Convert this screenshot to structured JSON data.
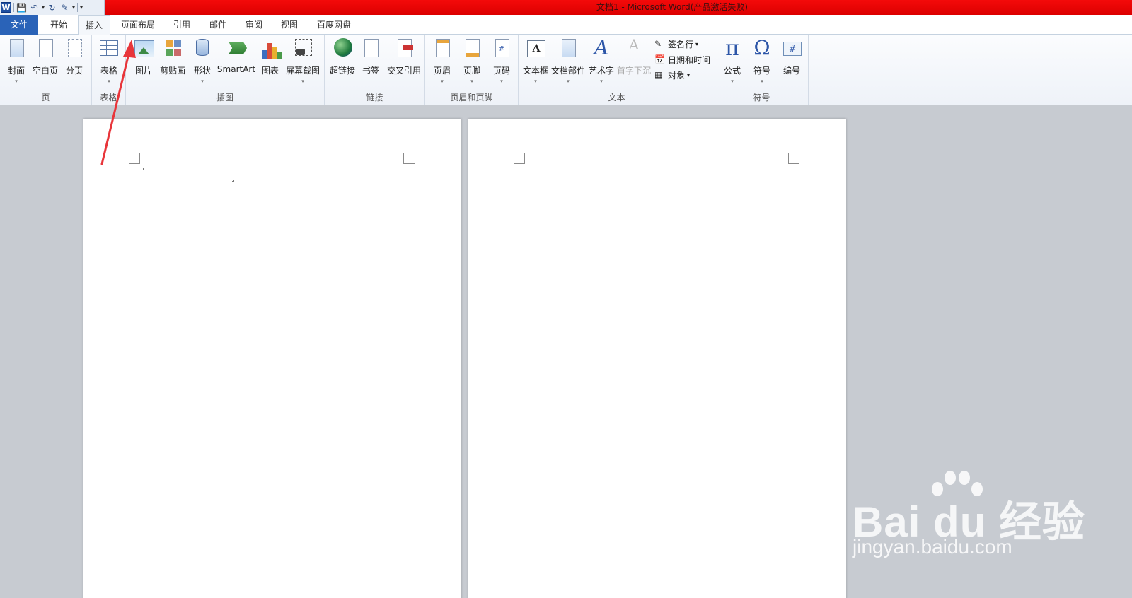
{
  "title_bar": {
    "title": "文档1 - Microsoft Word(产品激活失败)",
    "app_icon": "W",
    "qat": [
      "save-icon",
      "undo-icon",
      "redo-icon",
      "customize-icon"
    ]
  },
  "tabs": {
    "file": "文件",
    "home": "开始",
    "insert": "插入",
    "layout": "页面布局",
    "references": "引用",
    "mailings": "邮件",
    "review": "审阅",
    "view": "视图",
    "baidu": "百度网盘",
    "active": "插入"
  },
  "ribbon": {
    "pages": {
      "label": "页",
      "cover": "封面",
      "blank": "空白页",
      "break": "分页"
    },
    "tables": {
      "label": "表格",
      "table": "表格"
    },
    "illustrations": {
      "label": "插图",
      "picture": "图片",
      "clipart": "剪贴画",
      "shapes": "形状",
      "smartart": "SmartArt",
      "chart": "图表",
      "screenshot": "屏幕截图"
    },
    "links": {
      "label": "链接",
      "hyperlink": "超链接",
      "bookmark": "书签",
      "crossref": "交叉引用"
    },
    "headerfooter": {
      "label": "页眉和页脚",
      "header": "页眉",
      "footer": "页脚",
      "pagenum": "页码"
    },
    "text": {
      "label": "文本",
      "textbox": "文本框",
      "quickparts": "文档部件",
      "wordart": "艺术字",
      "dropcap": "首字下沉",
      "signature": "签名行",
      "datetime": "日期和时间",
      "object": "对象"
    },
    "symbols": {
      "label": "符号",
      "equation": "公式",
      "symbol": "符号",
      "number": "编号"
    }
  },
  "glyphs": {
    "pi": "π",
    "omega": "Ω",
    "hash": "#",
    "textA": "A",
    "dropdown": "▾"
  },
  "watermark": {
    "brand": "Bai du 经验",
    "url": "jingyan.baidu.com"
  },
  "colors": {
    "title_bar": "#e60000",
    "file_tab": "#2a63b8",
    "arrow": "#e8353a"
  }
}
